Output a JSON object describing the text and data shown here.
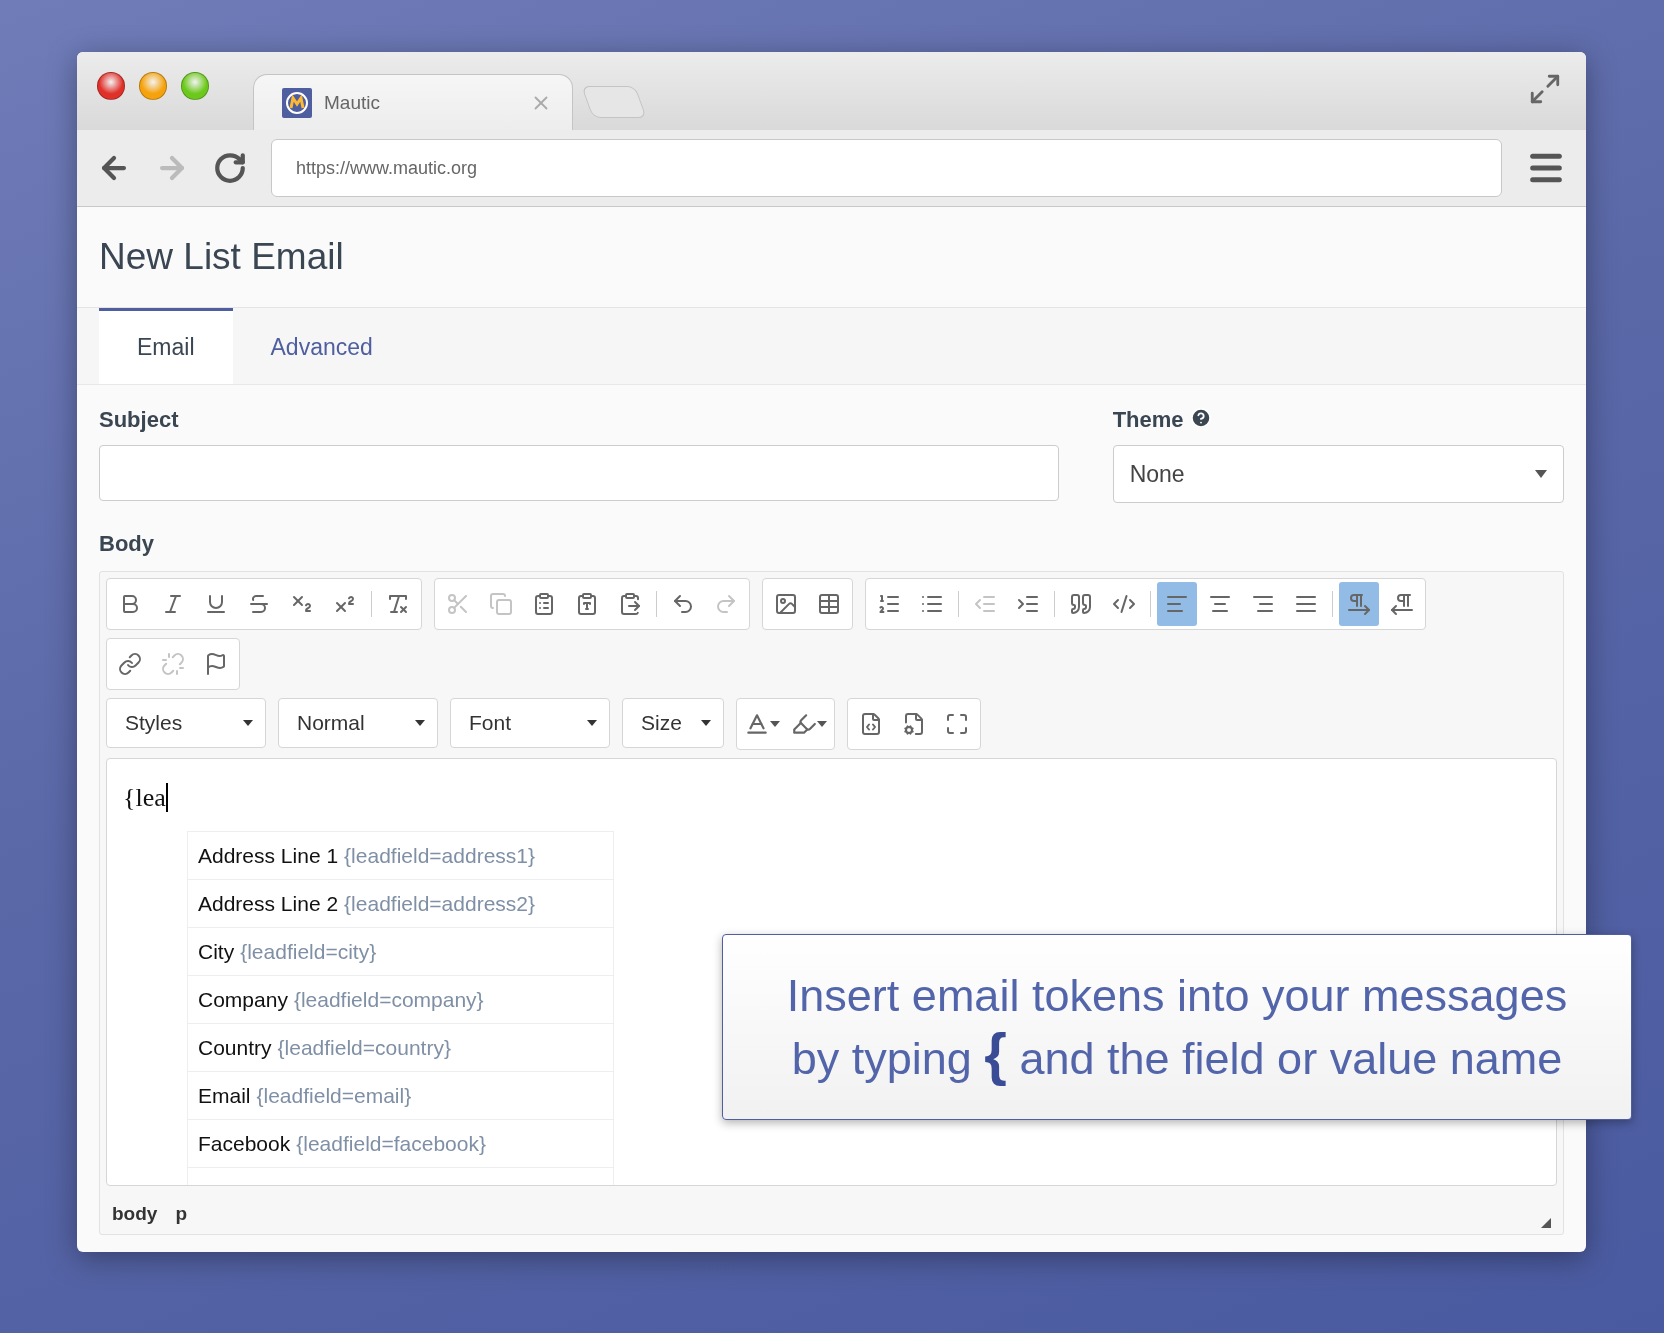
{
  "browser": {
    "tab_title": "Mautic",
    "url": "https://www.mautic.org"
  },
  "page": {
    "title": "New List Email"
  },
  "tabs": [
    {
      "label": "Email",
      "selected": true
    },
    {
      "label": "Advanced",
      "selected": false
    }
  ],
  "subject": {
    "label": "Subject"
  },
  "theme": {
    "label": "Theme",
    "value": "None"
  },
  "body": {
    "label": "Body",
    "toolbar_groups": [
      [
        {
          "active": false,
          "disabled": false
        },
        {
          "active": false,
          "disabled": false
        },
        {
          "active": false,
          "disabled": false
        },
        {
          "active": false,
          "disabled": false
        },
        {
          "active": false,
          "disabled": false
        },
        {
          "active": false,
          "disabled": false
        },
        {
          "active": false,
          "disabled": false
        }
      ],
      [
        {
          "active": false,
          "disabled": true
        },
        {
          "active": false,
          "disabled": true
        },
        {
          "active": false,
          "disabled": false
        },
        {
          "active": false,
          "disabled": false
        },
        {
          "active": false,
          "disabled": false
        },
        {
          "active": false,
          "disabled": false
        },
        {
          "active": false,
          "disabled": true
        }
      ],
      [
        {
          "active": false,
          "disabled": false
        },
        {
          "active": false,
          "disabled": false
        }
      ],
      [
        {
          "active": false,
          "disabled": false
        },
        {
          "active": false,
          "disabled": false
        },
        {
          "active": false,
          "disabled": true
        },
        {
          "active": false,
          "disabled": false
        },
        {
          "active": false,
          "disabled": false
        },
        {
          "active": false,
          "disabled": false
        },
        {
          "active": true,
          "disabled": false
        },
        {
          "active": false,
          "disabled": false
        },
        {
          "active": false,
          "disabled": false
        },
        {
          "active": false,
          "disabled": false
        },
        {
          "active": true,
          "disabled": false
        },
        {
          "active": false,
          "disabled": false
        }
      ],
      [
        {
          "active": false,
          "disabled": false
        },
        {
          "active": false,
          "disabled": true
        },
        {
          "active": false,
          "disabled": false
        }
      ]
    ],
    "dropdowns": [
      "Styles",
      "Normal",
      "Font",
      "Size"
    ],
    "content": "{lea",
    "suggestions": [
      {
        "label": "Address Line 1",
        "token": "{leadfield=address1}"
      },
      {
        "label": "Address Line 2",
        "token": "{leadfield=address2}"
      },
      {
        "label": "City",
        "token": "{leadfield=city}"
      },
      {
        "label": "Company",
        "token": "{leadfield=company}"
      },
      {
        "label": "Country",
        "token": "{leadfield=country}"
      },
      {
        "label": "Email",
        "token": "{leadfield=email}"
      },
      {
        "label": "Facebook",
        "token": "{leadfield=facebook}"
      }
    ],
    "path": [
      "body",
      "p"
    ]
  },
  "callout": {
    "text": "Insert email tokens into your messages by typing **{** and the field or value name"
  }
}
